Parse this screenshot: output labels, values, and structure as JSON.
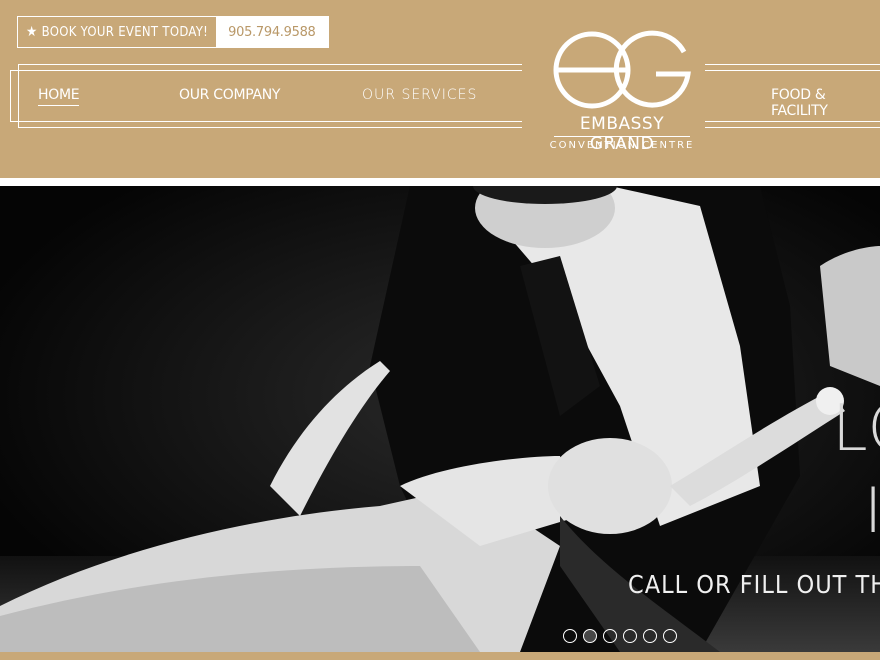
{
  "header": {
    "book_label": "BOOK YOUR EVENT TODAY!",
    "phone": "905.794.9588",
    "nav": {
      "home": "HOME",
      "company": "OUR COMPANY",
      "services": "OUR SERVICES",
      "food": "FOOD & FACILITY"
    },
    "logo": {
      "monogram": "EG",
      "name": "EMBASSY GRAND",
      "subtitle": "CONVENTION CENTRE"
    }
  },
  "hero": {
    "headline_partial": "LO",
    "line2_partial": "I",
    "cta_partial": "CALL OR FILL OUT THE",
    "slides": 6,
    "active_slide": 2
  },
  "colors": {
    "brand_gold": "#c8a878",
    "white": "#ffffff",
    "hero_bg": "#070707"
  }
}
